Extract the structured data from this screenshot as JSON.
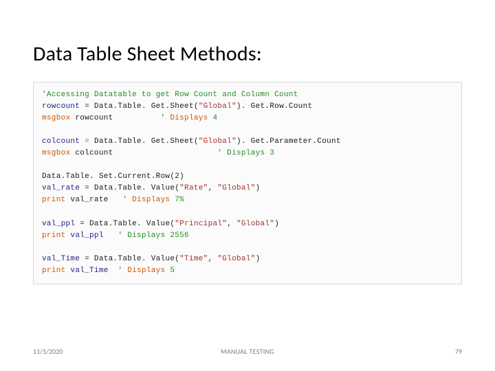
{
  "title": "Data Table Sheet Methods:",
  "code": {
    "l1": "'Accessing Datatable to get Row Count and Column Count",
    "l2_a": "rowcount",
    "l2_b": " = Data.Table. Get.Sheet(",
    "l2_c": "\"Global\"",
    "l2_d": "). Get.Row.Count",
    "l3_a": "msgbox",
    "l3_b": " rowcount          ",
    "l3_c": "' ",
    "l3_d": "Displays",
    "l3_e": " 4",
    "l4_a": "colcount",
    "l4_b": " = ",
    "l4_c": "Data.Table. Get.Sheet(",
    "l4_d": "\"Global\"",
    "l4_e": "). Get.Parameter.Count",
    "l5_a": "msgbox",
    "l5_b": " colcount                      ",
    "l5_c": "' Displays 3",
    "l6": "Data.Table. Set.Current.Row(2)",
    "l7_a": "val_rate",
    "l7_b": " = Data.Table. Value(",
    "l7_c": "\"Rate\"",
    "l7_d": ", ",
    "l7_e": "\"Global\"",
    "l7_f": ")",
    "l8_a": "print",
    "l8_b": " val_rate   ",
    "l8_c": "' ",
    "l8_d": "Displays",
    "l8_e": " 7%",
    "l9_a": "val_ppl",
    "l9_b": " = ",
    "l9_c": "Data.Table. Value(",
    "l9_d": "\"Principal\"",
    "l9_e": ", ",
    "l9_f": "\"Global\"",
    "l9_g": ")",
    "l10_a": "print ",
    "l10_b": "val_ppl",
    "l10_c": "   ' Displays 2556",
    "l11_a": "val_Time",
    "l11_b": " = Data.Table. Value(",
    "l11_c": "\"Time\"",
    "l11_d": ", ",
    "l11_e": "\"Global\"",
    "l11_f": ")",
    "l12_a": "print ",
    "l12_b": "val_Time",
    "l12_c": "  ' ",
    "l12_d": "Displays",
    "l12_e": " 5"
  },
  "footer": {
    "date": "11/5/2020",
    "label": "MANUAL TESTING",
    "page": "79"
  }
}
